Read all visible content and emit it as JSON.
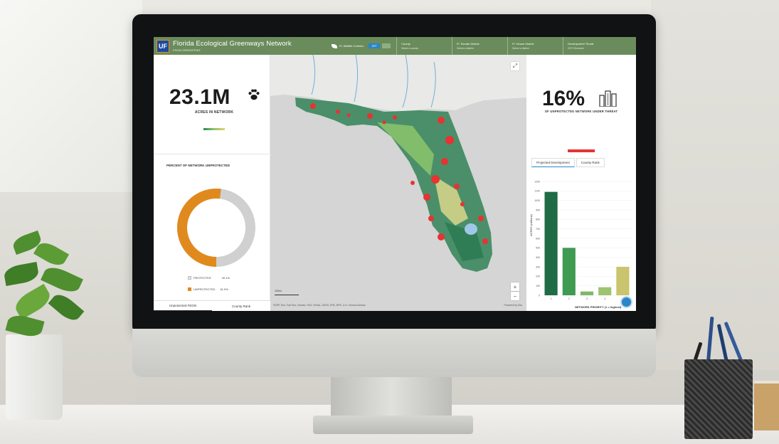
{
  "app": {
    "logo_text": "UF",
    "title": "Florida Ecological Greenways Network",
    "subtitle": "FROM GREENPRINT"
  },
  "header": {
    "toggle_label": "FL Wildlife Corridor",
    "toggle_value": "OFF",
    "filters": [
      {
        "label": "County",
        "value": "Select a county"
      },
      {
        "label": "Fl. Senate District",
        "value": "Select a district"
      },
      {
        "label": "Fl. House District",
        "value": "Select a district"
      },
      {
        "label": "Development Threat",
        "value": "2070 Scenario"
      }
    ]
  },
  "left": {
    "stat_value": "23.1M",
    "stat_caption": "ACRES IN NETWORK",
    "donut_title": "PERCENT OF NETWORK UNPROTECTED",
    "legend": [
      {
        "label": "PROTECTED",
        "value": "49.1%",
        "color": "#cfcfcf"
      },
      {
        "label": "UNPROTECTED",
        "value": "51.9%",
        "color": "#e08a1e"
      }
    ],
    "tabs": [
      "Unprotected FEGN",
      "County Rank"
    ]
  },
  "map": {
    "attribution": "FDEP, Esri, TomTom, Garmin, FAO, NOAA, USGS, EPA, NPS, U.S. Census Bureau",
    "powered_by": "Powered by Esri",
    "scale_label": "100mi",
    "zoom_in": "+",
    "zoom_out": "−",
    "expand": "⤢"
  },
  "right": {
    "stat_value": "16%",
    "stat_caption": "OF UNPROTECTED NETWORK UNDER THREAT",
    "tabs": [
      "Projected Development",
      "County Rank"
    ]
  },
  "chart_data": {
    "type": "bar",
    "categories": [
      "1",
      "2",
      "3",
      "4",
      "5"
    ],
    "values": [
      1090,
      500,
      40,
      85,
      300
    ],
    "ylabel": "ACRES (millions)",
    "xlabel": "NETWORK PRIORITY (1 = highest)",
    "ylim": [
      0,
      1200
    ],
    "yticks": [
      0,
      100,
      200,
      300,
      400,
      500,
      600,
      700,
      800,
      900,
      1000,
      1100,
      1200
    ],
    "colors": [
      "#1e6b45",
      "#3f9a52",
      "#7fb96a",
      "#9ec46f",
      "#c9c46d"
    ]
  }
}
